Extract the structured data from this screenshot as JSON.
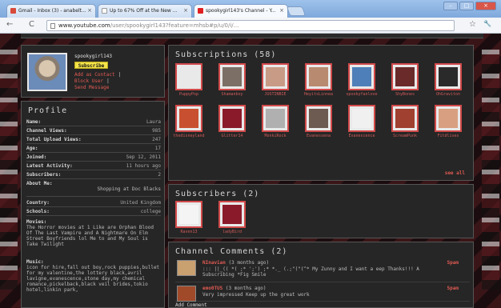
{
  "browser": {
    "tabs": [
      {
        "label": "Gmail - Inbox (3) - anabelt...",
        "favicon_color": "#d84a3a",
        "active": false
      },
      {
        "label": "Up to 67% Off at the New ...",
        "favicon_color": "#ffffff",
        "active": false
      },
      {
        "label": "spookygirl143's Channel - Y...",
        "favicon_color": "#e02020",
        "active": true
      }
    ],
    "url_prefix": "www.youtube.com",
    "url_rest": "/user/spookygirl143?feature=mhsb#p/u/0/i/...",
    "nav": {
      "back": "←",
      "reload": "C"
    },
    "tools": {
      "star": "☆",
      "wrench": "🔧"
    },
    "window_buttons": {
      "minimize": "–",
      "maximize": "□",
      "close": "×"
    }
  },
  "channel": {
    "username": "spookygirl143",
    "subscribe_label": "Subscribe",
    "actions": [
      "Add as Contact",
      "Block User",
      "Send Message"
    ]
  },
  "profile": {
    "title": "Profile",
    "rows": [
      {
        "k": "Name:",
        "v": "Laura"
      },
      {
        "k": "Channel Views:",
        "v": "985"
      },
      {
        "k": "Total Upload Views:",
        "v": "247"
      },
      {
        "k": "Age:",
        "v": "17"
      },
      {
        "k": "Joined:",
        "v": "Sep 12, 2011"
      },
      {
        "k": "Latest Activity:",
        "v": "11 hours ago"
      },
      {
        "k": "Subscribers:",
        "v": "2"
      }
    ],
    "about_label": "About Me:",
    "about_value": "Shopping at Doc Blacks",
    "rows2": [
      {
        "k": "Country:",
        "v": "United Kingdom"
      },
      {
        "k": "Schools:",
        "v": "college"
      }
    ],
    "movies_label": "Movies:",
    "movies_text": "The Horror movies at 1 Like are Orphan Blood Of The Last Vampire and A Nightmare On Elm Street Boyfriends lol Me to and My Soul is Take Twilight",
    "music_label": "Music:",
    "music_text": "icon for hire,fall out boy,rock puppies,bullet for my valentine,the lottery black,avril lavigne,evanescence,stone day,my chemical romance,pickelback,black veil brides,tokio hotel,linkin park,"
  },
  "subscriptions": {
    "title": "Subscriptions (58)",
    "items": [
      {
        "label": "PuppyPop",
        "color": "#e9e9e9"
      },
      {
        "label": "Shamanboy",
        "color": "#7b6f66"
      },
      {
        "label": "JUSTINBIE",
        "color": "#c89b86"
      },
      {
        "label": "HeyitsLinnea",
        "color": "#b88a6f"
      },
      {
        "label": "spookyfanlove",
        "color": "#4e7fb8"
      },
      {
        "label": "ShyBones",
        "color": "#6a2a2a"
      },
      {
        "label": "OhGraviton",
        "color": "#2a2a2a"
      },
      {
        "label": "thedisneyland",
        "color": "#c85030"
      },
      {
        "label": "Glitter14",
        "color": "#8a1a2a"
      },
      {
        "label": "MonkiRock",
        "color": "#b0b0b0"
      },
      {
        "label": "Evanessena",
        "color": "#6d5a50"
      },
      {
        "label": "Evanescence",
        "color": "#f0f0f0"
      },
      {
        "label": "ScreamPunk",
        "color": "#a04030"
      },
      {
        "label": "Fitdlives",
        "color": "#d8a080"
      }
    ],
    "see_all": "see all"
  },
  "subscribers": {
    "title": "Subscribers (2)",
    "items": [
      {
        "label": "Raven13",
        "color": "#f4f4f4"
      },
      {
        "label": "ladyBird",
        "color": "#8a1a2a"
      }
    ]
  },
  "comments": {
    "title": "Channel Comments (2)",
    "items": [
      {
        "author": "NInavian",
        "when": "(3 months ago)",
        "action": "Spam",
        "text": "::: ||_(( *( ;* ';') ;* *._ (.;\"(\"(^* My Zunny and I want  a  eep Thanks!!! A Subscribing *Fig Smile",
        "avatar_color": "#c9a070"
      },
      {
        "author": "emo0TUS",
        "when": "(3 months ago)",
        "action": "Spam",
        "text": "Very impressed Keep up  the  great work",
        "avatar_color": "#a04a2a"
      }
    ],
    "add_label": "Add Comment"
  }
}
